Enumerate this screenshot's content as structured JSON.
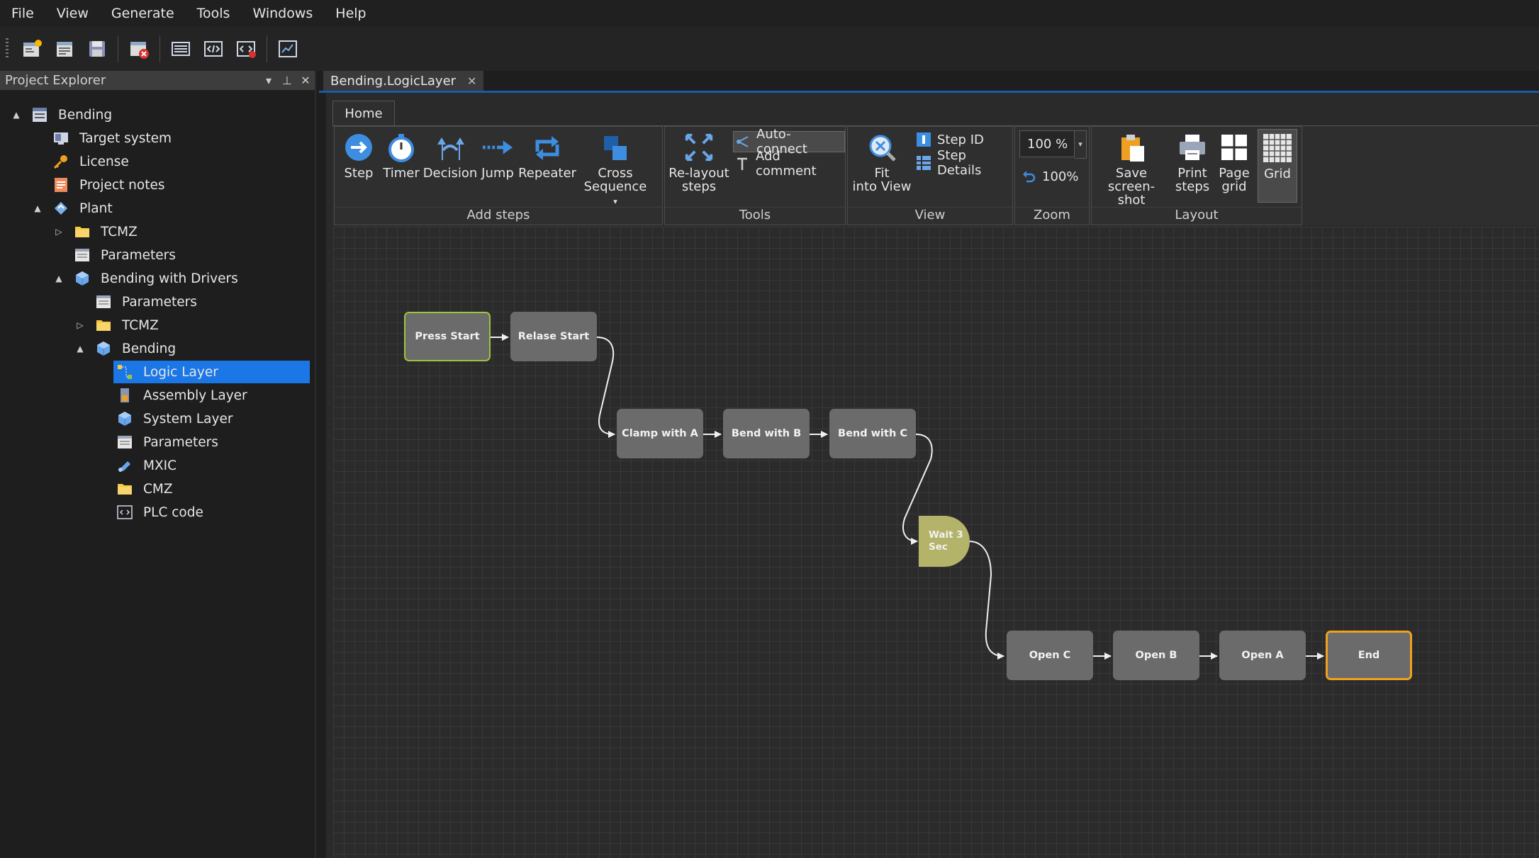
{
  "menu": [
    "File",
    "View",
    "Generate",
    "Tools",
    "Windows",
    "Help"
  ],
  "toolbar_icons": [
    "new-project-icon",
    "open-icon",
    "save-icon",
    "close-project-icon",
    "panel-icon",
    "code-icon",
    "code-error-icon",
    "chart-icon"
  ],
  "explorer": {
    "title": "Project Explorer",
    "items": [
      {
        "label": "Bending",
        "level": 0,
        "expander": "▲",
        "icon": "project-icon"
      },
      {
        "label": "Target system",
        "level": 1,
        "expander": "",
        "icon": "target-system-icon"
      },
      {
        "label": "License",
        "level": 1,
        "expander": "",
        "icon": "key-icon"
      },
      {
        "label": "Project notes",
        "level": 1,
        "expander": "",
        "icon": "notes-icon"
      },
      {
        "label": "Plant",
        "level": 1,
        "expander": "▲",
        "icon": "plant-icon"
      },
      {
        "label": "TCMZ",
        "level": 2,
        "expander": "▷",
        "icon": "folder-icon"
      },
      {
        "label": "Parameters",
        "level": 2,
        "expander": "",
        "icon": "parameters-icon"
      },
      {
        "label": "Bending with Drivers",
        "level": 2,
        "expander": "▲",
        "icon": "cube-icon"
      },
      {
        "label": "Parameters",
        "level": 3,
        "expander": "",
        "icon": "parameters-icon"
      },
      {
        "label": "TCMZ",
        "level": 3,
        "expander": "▷",
        "icon": "folder-icon"
      },
      {
        "label": "Bending",
        "level": 3,
        "expander": "▲",
        "icon": "cube-icon"
      },
      {
        "label": "Logic Layer",
        "level": 4,
        "expander": "",
        "icon": "logic-layer-icon",
        "selected": true
      },
      {
        "label": "Assembly Layer",
        "level": 4,
        "expander": "",
        "icon": "assembly-layer-icon"
      },
      {
        "label": "System Layer",
        "level": 4,
        "expander": "",
        "icon": "cube-icon"
      },
      {
        "label": "Parameters",
        "level": 4,
        "expander": "",
        "icon": "parameters-icon"
      },
      {
        "label": "MXIC",
        "level": 4,
        "expander": "",
        "icon": "mxic-icon"
      },
      {
        "label": "CMZ",
        "level": 4,
        "expander": "",
        "icon": "folder-icon"
      },
      {
        "label": "PLC code",
        "level": 4,
        "expander": "",
        "icon": "plc-code-icon"
      }
    ]
  },
  "doc_tab": {
    "label": "Bending.LogicLayer",
    "close": "✕"
  },
  "ribbon": {
    "tab": "Home",
    "groups": {
      "add_steps": "Add steps",
      "tools": "Tools",
      "view": "View",
      "zoom": "Zoom",
      "layout": "Layout"
    },
    "buttons": {
      "step": "Step",
      "timer": "Timer",
      "decision": "Decision",
      "jump": "Jump",
      "repeater": "Repeater",
      "cross_sequence_1": "Cross",
      "cross_sequence_2": "Sequence",
      "relayout_1": "Re-layout",
      "relayout_2": "steps",
      "auto_connect": "Auto-connect",
      "add_comment": "Add comment",
      "fit_1": "Fit",
      "fit_2": "into View",
      "step_id": "Step ID",
      "step_details": "Step Details",
      "zoom_value": "100 %",
      "zoom_reset": "100%",
      "save_1": "Save",
      "save_2": "screen-shot",
      "print_1": "Print",
      "print_2": "steps",
      "page_1": "Page",
      "page_2": "grid",
      "grid": "Grid"
    }
  },
  "flow": {
    "nodes": [
      {
        "id": "press-start",
        "label": "Press Start",
        "kind": "start"
      },
      {
        "id": "relase-start",
        "label": "Relase Start",
        "kind": "step"
      },
      {
        "id": "clamp-with-a",
        "label": "Clamp with A",
        "kind": "step"
      },
      {
        "id": "bend-with-b",
        "label": "Bend with B",
        "kind": "step"
      },
      {
        "id": "bend-with-c",
        "label": "Bend with C",
        "kind": "step"
      },
      {
        "id": "wait-3-sec",
        "label_1": "Wait 3",
        "label_2": "Sec",
        "kind": "timer"
      },
      {
        "id": "open-c",
        "label": "Open C",
        "kind": "step"
      },
      {
        "id": "open-b",
        "label": "Open B",
        "kind": "step"
      },
      {
        "id": "open-a",
        "label": "Open A",
        "kind": "step"
      },
      {
        "id": "end",
        "label": "End",
        "kind": "end"
      }
    ],
    "connections": [
      [
        "press-start",
        "relase-start"
      ],
      [
        "relase-start",
        "clamp-with-a"
      ],
      [
        "clamp-with-a",
        "bend-with-b"
      ],
      [
        "bend-with-b",
        "bend-with-c"
      ],
      [
        "bend-with-c",
        "wait-3-sec"
      ],
      [
        "wait-3-sec",
        "open-c"
      ],
      [
        "open-c",
        "open-b"
      ],
      [
        "open-b",
        "open-a"
      ],
      [
        "open-a",
        "end"
      ]
    ]
  },
  "colors": {
    "selection": "#1b77e6",
    "start_border": "#9bc53d",
    "end_border": "#f0a020",
    "step_fill": "#6b6b6b",
    "timer_fill": "#b3b36a"
  }
}
